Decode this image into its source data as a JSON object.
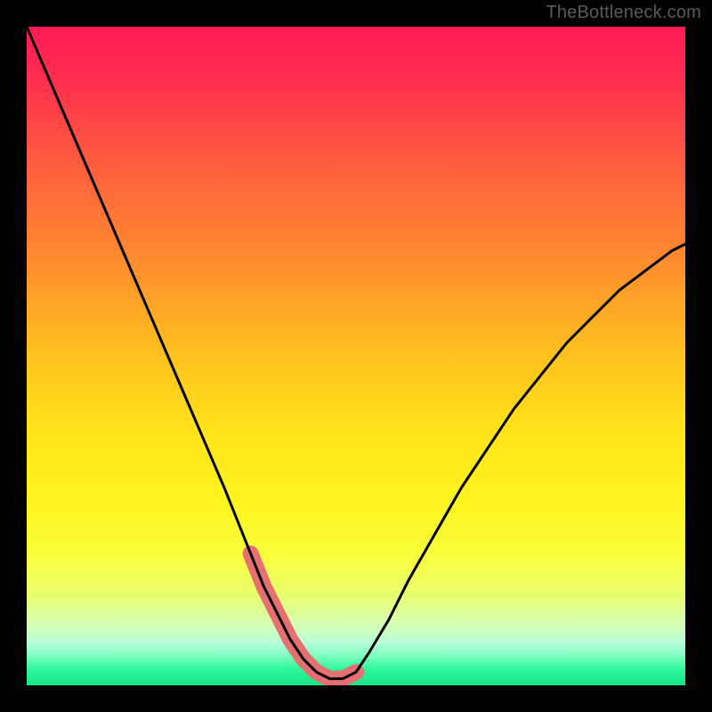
{
  "watermark": "TheBottleneck.com",
  "colors": {
    "background": "#000000",
    "curve": "#000000",
    "marker": "#e66f72",
    "gradient_stops": [
      {
        "offset": 0.0,
        "color": "#ff1a53"
      },
      {
        "offset": 0.08,
        "color": "#ff2e4f"
      },
      {
        "offset": 0.2,
        "color": "#ff5a3f"
      },
      {
        "offset": 0.35,
        "color": "#ff8a2e"
      },
      {
        "offset": 0.5,
        "color": "#ffc21e"
      },
      {
        "offset": 0.62,
        "color": "#ffe419"
      },
      {
        "offset": 0.72,
        "color": "#fff41e"
      },
      {
        "offset": 0.8,
        "color": "#f8ff3a"
      },
      {
        "offset": 0.86,
        "color": "#eaff6a"
      },
      {
        "offset": 0.905,
        "color": "#d8ffb0"
      },
      {
        "offset": 0.935,
        "color": "#b8ffd8"
      },
      {
        "offset": 0.955,
        "color": "#7effc0"
      },
      {
        "offset": 0.975,
        "color": "#30f59a"
      },
      {
        "offset": 1.0,
        "color": "#12e887"
      }
    ]
  },
  "chart_data": {
    "type": "line",
    "title": "",
    "xlabel": "",
    "ylabel": "",
    "xlim": [
      0,
      100
    ],
    "ylim": [
      0,
      100
    ],
    "grid": false,
    "series": [
      {
        "name": "curve",
        "x": [
          0,
          3,
          6,
          9,
          12,
          15,
          18,
          21,
          24,
          27,
          30,
          32,
          34,
          36,
          38,
          40,
          42,
          44,
          46,
          48,
          50,
          52,
          55,
          58,
          62,
          66,
          70,
          74,
          78,
          82,
          86,
          90,
          94,
          98,
          100
        ],
        "y": [
          100,
          93,
          86,
          79,
          72,
          65,
          58,
          51,
          44,
          37,
          30,
          25,
          20,
          15,
          11,
          7,
          4,
          2,
          1,
          1,
          2,
          5,
          10,
          16,
          23,
          30,
          36,
          42,
          47,
          52,
          56,
          60,
          63,
          66,
          67
        ]
      }
    ],
    "markers": {
      "name": "highlight",
      "x": [
        34,
        36,
        38,
        40,
        42,
        44,
        46,
        48,
        50
      ],
      "y": [
        20,
        15,
        11,
        7,
        4,
        2,
        1,
        1,
        2
      ]
    }
  }
}
